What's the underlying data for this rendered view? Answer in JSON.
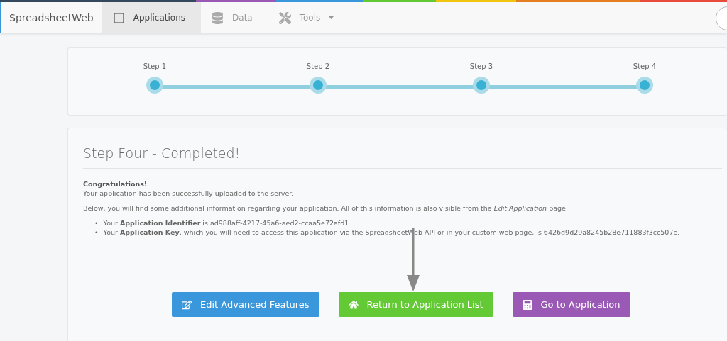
{
  "nav": {
    "brand": "SpreadsheetWeb",
    "items": [
      {
        "label": "Applications",
        "selected": true,
        "has_menu": false
      },
      {
        "label": "Data",
        "selected": false,
        "has_menu": false
      },
      {
        "label": "Tools",
        "selected": false,
        "has_menu": true
      }
    ]
  },
  "steps": [
    {
      "label": "Step 1"
    },
    {
      "label": "Step 2"
    },
    {
      "label": "Step 3"
    },
    {
      "label": "Step 4"
    }
  ],
  "content": {
    "title": "Step Four - Completed!",
    "heading": "Congratulations!",
    "lines": [
      "Your application has been successfully uploaded to the server.",
      "Below, you will find some additional information regarding your application. All of this information is also visible from the *Edit Application* page."
    ],
    "bullet_marker": "•",
    "bullets": [
      "Your **Application Identifier** is ad988aff-4217-45a6-aed2-ccaa5e72afd1.",
      "Your **Application Key**, which you will need to access this application via the SpreadsheetWeb API or in your custom web page, is 6426d9d29a8245b28e711883f3cc507e."
    ]
  },
  "buttons": [
    {
      "label": "Edit Advanced Features",
      "color": "#3a97dc"
    },
    {
      "label": "Return to Application List",
      "color": "#63c934"
    },
    {
      "label": "Go to Application",
      "color": "#9b59b6"
    }
  ]
}
